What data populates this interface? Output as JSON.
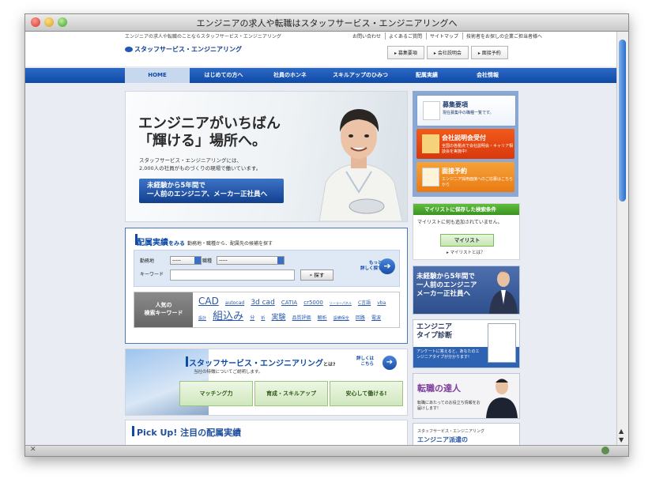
{
  "window": {
    "title": "エンジニアの求人や転職はスタッフサービス・エンジニアリングへ"
  },
  "header": {
    "tagline": "エンジニアの求人や転職のことならスタッフサービス・エンジニアリング",
    "links": [
      "お問い合わせ",
      "よくあるご質問",
      "サイトマップ",
      "技術者をお探しの企業ご担当者様へ"
    ],
    "logo": "スタッフサービス・エンジニアリング",
    "buttons": [
      "▸ 募集要項",
      "▸ 会社説明会",
      "▸ 面接予約"
    ]
  },
  "nav": [
    "HOME",
    "はじめての方へ",
    "社員のホンネ",
    "スキルアップのひみつ",
    "配属実績",
    "会社情報"
  ],
  "hero": {
    "line1": "エンジニアがいちばん",
    "line2": "「輝ける」場所へ。",
    "sub1": "スタッフサービス・エンジニアリングには、",
    "sub2": "2,000人の社員がものづくりの現場で働いています。",
    "btn1": "未経験から5年間で",
    "btn2": "一人前のエンジニア、メーカー正社員へ"
  },
  "side": {
    "c1_title": "募集要項",
    "c1_sub": "現在募集中の職種一覧です。",
    "c2_title": "会社説明会受付",
    "c2_sub": "全国の各拠点で会社説明会・キャリア相談会を実施中!",
    "c3_title": "面接予約",
    "c3_sub": "エンジニア採用面接へのご応募はこちらから",
    "mylist_head": "マイリストに保存した検索条件",
    "mylist_text": "マイリストに何も追加されていません。",
    "mylist_btn": "マイリスト",
    "mylist_link": "▸ マイリストとは？"
  },
  "banners": {
    "b1_l1": "未経験から5年間で",
    "b1_l2": "一人前のエンジニア",
    "b1_l3": "メーカー正社員へ",
    "b2_l1": "エンジニア",
    "b2_l2": "タイプ診断",
    "b2_sub": "アンケートに答えると、あなたのエンジニアタイプが分かります!",
    "b3_title": "転職の達人",
    "b3_sub": "転職にあたってのお役立ち情報をお届けします!",
    "b4_l1": "スタッフサービス・エンジニアリング",
    "b4_l2": "エンジニア派遣の"
  },
  "search": {
    "title": "配属実績",
    "title_suffix": "をみる",
    "subtitle": "勤務地・職種から、配属先の候補を探す",
    "label_area": "勤務地",
    "label_job": "職種",
    "select_area": "-----",
    "select_job": "-----",
    "label_keyword": "キーワード",
    "btn": "探す",
    "more1": "もっと",
    "more2": "詳しく探す",
    "popular1": "人気の",
    "popular2": "検索キーワード",
    "keywords": [
      {
        "t": "CAD",
        "s": "12px"
      },
      {
        "t": "autocad",
        "s": "6px"
      },
      {
        "t": "3d cad",
        "s": "9px"
      },
      {
        "t": "CATIA",
        "s": "7px"
      },
      {
        "t": "cr5000",
        "s": "7px"
      },
      {
        "t": "ソーラーパネル",
        "s": "4px"
      },
      {
        "t": "C言語",
        "s": "6px"
      },
      {
        "t": "vba",
        "s": "6px"
      },
      {
        "t": "設計",
        "s": "5px"
      },
      {
        "t": "組込み",
        "s": "13px"
      },
      {
        "t": "分",
        "s": "6px"
      },
      {
        "t": "析",
        "s": "5px"
      },
      {
        "t": "実験",
        "s": "9px"
      },
      {
        "t": "品質評価",
        "s": "6px"
      },
      {
        "t": "解析",
        "s": "6px"
      },
      {
        "t": "設備保全",
        "s": "5px"
      },
      {
        "t": "回路",
        "s": "6px"
      },
      {
        "t": "電波",
        "s": "6px"
      }
    ]
  },
  "about": {
    "title": "スタッフサービス・エンジニアリング",
    "title_suffix": "とは?",
    "sub": "当社の特徴についてご説明します。",
    "more1": "詳しくは",
    "more2": "こちら",
    "buttons": [
      "マッチング力",
      "育成・スキルアップ",
      "安心して働ける!"
    ]
  },
  "pickup": {
    "title": "Pick Up! 注目の配属実績"
  },
  "colors": {
    "accent": "#0f4aa7",
    "orange": "#ea7a12",
    "green": "#3b9321"
  }
}
